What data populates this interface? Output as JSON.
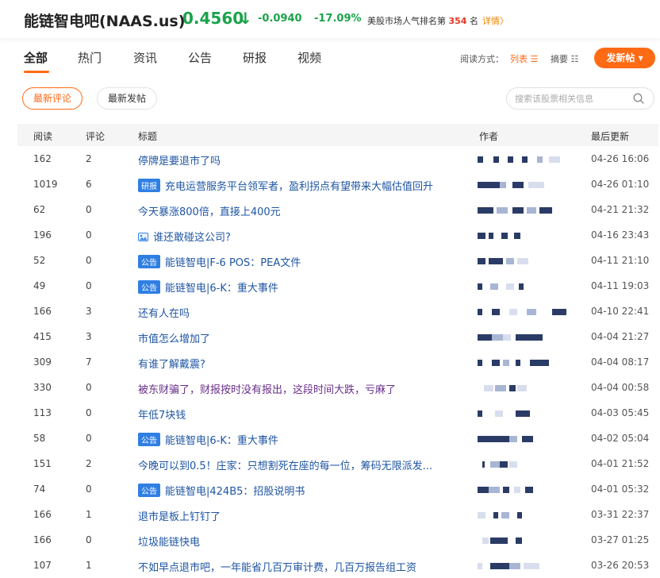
{
  "header": {
    "title": "能链智电吧(NAAS.us)",
    "price": "0.4560",
    "arrow": "↓",
    "change": "-0.0940",
    "change_pct": "-17.09%",
    "rank_prefix": "美股市场人气排名第",
    "rank_num": "354",
    "rank_suffix": "名",
    "detail": "详情〉"
  },
  "tabs": [
    "全部",
    "热门",
    "资讯",
    "公告",
    "研报",
    "视频"
  ],
  "read_mode": {
    "label": "阅读方式：",
    "list": "列表 ☰",
    "summary": "摘要 ☷"
  },
  "post_button": "发新帖 ▾",
  "filters": {
    "latest_comment": "最新评论",
    "latest_post": "最新发帖"
  },
  "search": {
    "placeholder": "搜索该股票相关信息"
  },
  "table": {
    "headers": {
      "read": "阅读",
      "comment": "评论",
      "title": "标题",
      "author": "作者",
      "updated": "最后更新"
    },
    "rows": [
      {
        "read": "162",
        "comment": "2",
        "tag": "",
        "title": "停牌是要退市了吗",
        "time": "04-26 16:06"
      },
      {
        "read": "1019",
        "comment": "6",
        "tag": "研报",
        "title": "充电运营服务平台领军者，盈利拐点有望带来大幅估值回升",
        "time": "04-26 01:10"
      },
      {
        "read": "62",
        "comment": "0",
        "tag": "",
        "title": "今天暴涨800倍，直接上400元",
        "time": "04-21 21:32"
      },
      {
        "read": "196",
        "comment": "0",
        "tag": "img",
        "title": "谁还敢碰这公司?",
        "time": "04-16 23:43"
      },
      {
        "read": "52",
        "comment": "0",
        "tag": "公告",
        "title": "能链智电|F-6 POS：PEA文件",
        "time": "04-11 21:10"
      },
      {
        "read": "49",
        "comment": "0",
        "tag": "公告",
        "title": "能链智电|6-K：重大事件",
        "time": "04-11 19:03"
      },
      {
        "read": "166",
        "comment": "3",
        "tag": "",
        "title": "还有人在吗",
        "time": "04-10 22:41"
      },
      {
        "read": "415",
        "comment": "3",
        "tag": "",
        "title": "市值怎么增加了",
        "time": "04-04 21:27"
      },
      {
        "read": "309",
        "comment": "7",
        "tag": "",
        "title": "有谁了解戴震?",
        "time": "04-04 08:17"
      },
      {
        "read": "330",
        "comment": "0",
        "tag": "",
        "title": "被东财骗了，财报按时没有报出，这段时间大跌，亏麻了",
        "time": "04-04 00:58",
        "visited": true
      },
      {
        "read": "113",
        "comment": "0",
        "tag": "",
        "title": "年低7块钱",
        "time": "04-03 05:45"
      },
      {
        "read": "58",
        "comment": "0",
        "tag": "公告",
        "title": "能链智电|6-K：重大事件",
        "time": "04-02 05:04"
      },
      {
        "read": "151",
        "comment": "2",
        "tag": "",
        "title": "今晚可以到0.5！庄家：只想割死在座的每一位，筹码无限派发...",
        "time": "04-01 21:52"
      },
      {
        "read": "74",
        "comment": "0",
        "tag": "公告",
        "title": "能链智电|424B5：招股说明书",
        "time": "04-01 05:32"
      },
      {
        "read": "166",
        "comment": "1",
        "tag": "",
        "title": "退市是板上钉钉了",
        "time": "03-31 22:37"
      },
      {
        "read": "166",
        "comment": "0",
        "tag": "",
        "title": "垃圾能链快电",
        "time": "03-27 01:25"
      },
      {
        "read": "107",
        "comment": "1",
        "tag": "",
        "title": "不如早点退市吧，一年能省几百万审计费，几百万报告组工资",
        "time": "03-26 20:53"
      }
    ]
  },
  "colors": {
    "accent": "#ff6a14",
    "down_green": "#1ba34a",
    "link_blue": "#1e55a3",
    "tag_blue": "#2f7fe3"
  }
}
